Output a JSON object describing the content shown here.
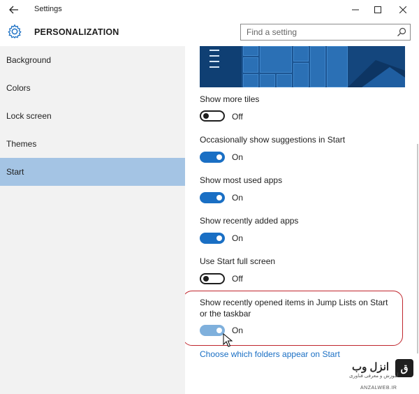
{
  "window": {
    "title": "Settings"
  },
  "header": {
    "page_title": "PERSONALIZATION",
    "search_placeholder": "Find a setting"
  },
  "sidebar": {
    "items": [
      {
        "label": "Background"
      },
      {
        "label": "Colors"
      },
      {
        "label": "Lock screen"
      },
      {
        "label": "Themes"
      },
      {
        "label": "Start",
        "active": true
      }
    ]
  },
  "settings": [
    {
      "label": "Show more tiles",
      "state": "Off"
    },
    {
      "label": "Occasionally show suggestions in Start",
      "state": "On"
    },
    {
      "label": "Show most used apps",
      "state": "On"
    },
    {
      "label": "Show recently added apps",
      "state": "On"
    },
    {
      "label": "Use Start full screen",
      "state": "Off"
    },
    {
      "label_line1": "Show recently opened items in Jump Lists on Start",
      "label_line2": "or the taskbar",
      "state": "On"
    }
  ],
  "link": {
    "label": "Choose which folders appear on Start"
  },
  "watermark": {
    "brand": "انزل وب",
    "tagline": "آموزش و معرفی فناوری",
    "url": "ANZALWEB.IR"
  },
  "colors": {
    "accent": "#1a6fc4",
    "sidebar_bg": "#f2f2f2",
    "active_item": "#a4c4e4",
    "highlight": "#c0262d"
  }
}
